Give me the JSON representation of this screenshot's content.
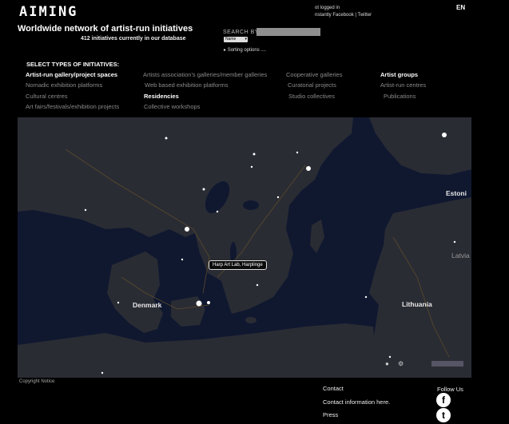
{
  "header": {
    "logo": "AIMING",
    "login_line1": "ot logged in",
    "login_line2": "nstantly Facebook | Twitter",
    "language": "EN",
    "tagline": "Worldwide network of artist-run initiatives",
    "count_text": "412 initiatives currently in our database"
  },
  "search": {
    "label": "SEARCH BY",
    "value": "",
    "select_value": "Name",
    "sorting_label": "Sorting options ...."
  },
  "types": {
    "heading": "SELECT TYPES OF INITIATIVES:",
    "items": [
      {
        "label": "Artist-run gallery/project spaces",
        "selected": true
      },
      {
        "label": "Artists association's galleries/member galleries",
        "selected": false
      },
      {
        "label": "Cooperative galleries",
        "selected": false
      },
      {
        "label": "Artist groups",
        "selected": true
      },
      {
        "label": "Nomadic exhibition platforms",
        "selected": false
      },
      {
        "label": "Web based exhibition platforms",
        "selected": false
      },
      {
        "label": "Curatorial projects",
        "selected": false
      },
      {
        "label": "Artist-run centres",
        "selected": false
      },
      {
        "label": "Cultural centres",
        "selected": false
      },
      {
        "label": "Residencies",
        "selected": true
      },
      {
        "label": "Studio collectives",
        "selected": false
      },
      {
        "label": "Publications",
        "selected": false
      },
      {
        "label": "Art fairs/festivals/exhibition projects",
        "selected": false
      },
      {
        "label": "Collective workshops",
        "selected": false
      }
    ]
  },
  "map": {
    "tooltip": "Harp Art Lab, Harplinge",
    "places": {
      "estonia": "Estoni",
      "latvia": "Latvia",
      "lithuania": "Lithuania",
      "denmark": "Denmark"
    },
    "colors": {
      "sea": "#101830",
      "land": "#2a2c34"
    }
  },
  "footer": {
    "copyright": "Copyright Notice",
    "contact": "Contact",
    "contact_info": "Contact information here.",
    "press": "Press",
    "follow_us": "Follow Us",
    "facebook_glyph": "f",
    "twitter_glyph": "t"
  }
}
